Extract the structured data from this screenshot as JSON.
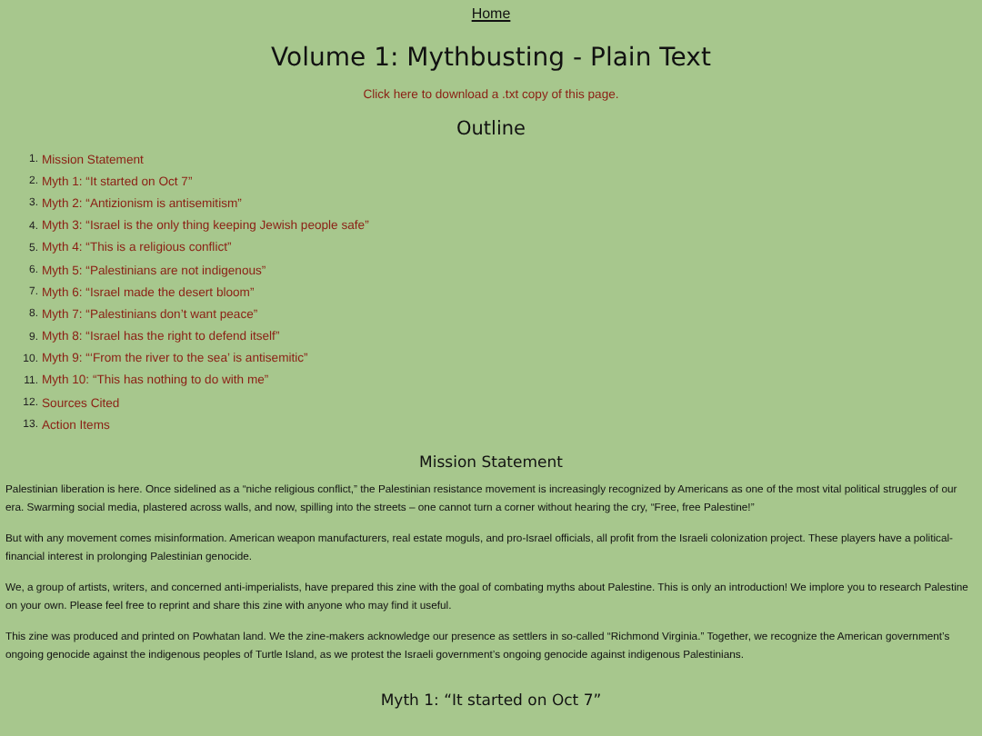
{
  "nav": {
    "home_link": "Home"
  },
  "title": "Volume 1: Mythbusting - Plain Text",
  "download_link": "Click here to download a .txt copy of this page.",
  "outline": {
    "heading": "Outline",
    "items": [
      {
        "number": "1.",
        "label": "Mission Statement"
      },
      {
        "number": "2.",
        "label": "Myth 1: “It started on Oct 7”"
      },
      {
        "number": "3.",
        "label": "Myth 2: “Antizionism is antisemitism”"
      },
      {
        "number": "4.",
        "label": "Myth 3: “Israel is the only thing keeping Jewish people safe”"
      },
      {
        "number": "5.",
        "label": "Myth 4: “This is a religious conflict”"
      },
      {
        "number": "6.",
        "label": "Myth 5: “Palestinians are not indigenous”"
      },
      {
        "number": "7.",
        "label": "Myth 6: “Israel made the desert bloom”"
      },
      {
        "number": "8.",
        "label": "Myth 7: “Palestinians don’t want peace”"
      },
      {
        "number": "9.",
        "label": "Myth 8: “Israel has the right to defend itself”"
      },
      {
        "number": "10.",
        "label": "Myth 9: “‘From the river to the sea’ is antisemitic”"
      },
      {
        "number": "11.",
        "label": "Myth 10: “This has nothing to do with me”"
      },
      {
        "number": "12.",
        "label": "Sources Cited"
      },
      {
        "number": "13.",
        "label": "Action Items"
      }
    ]
  },
  "sections": [
    {
      "heading": "Mission Statement",
      "paragraphs": [
        "Palestinian liberation is here. Once sidelined as a “niche religious conflict,” the Palestinian resistance movement is increasingly recognized by Americans as one of the most vital political struggles of our era. Swarming social media, plastered across walls, and now, spilling into the streets – one cannot turn a corner without hearing the cry, “Free, free Palestine!”",
        "But with any movement comes misinformation. American weapon manufacturers, real estate moguls, and pro-Israel officials, all profit from the Israeli colonization project. These players have a political-financial interest in prolonging Palestinian genocide.",
        "We, a group of artists, writers, and concerned anti-imperialists, have prepared this zine with the goal of combating myths about Palestine. This is only an introduction! We implore you to research Palestine on your own. Please feel free to reprint and share this zine with anyone who may find it useful.",
        "This zine was produced and printed on Powhatan land. We the zine-makers acknowledge our presence as settlers in so-called “Richmond Virginia.” Together, we recognize the American government’s ongoing genocide against the indigenous peoples of Turtle Island, as we protest the Israeli government’s ongoing genocide against indigenous Palestinians."
      ]
    },
    {
      "heading": "Myth 1: “It started on Oct 7”"
    }
  ]
}
